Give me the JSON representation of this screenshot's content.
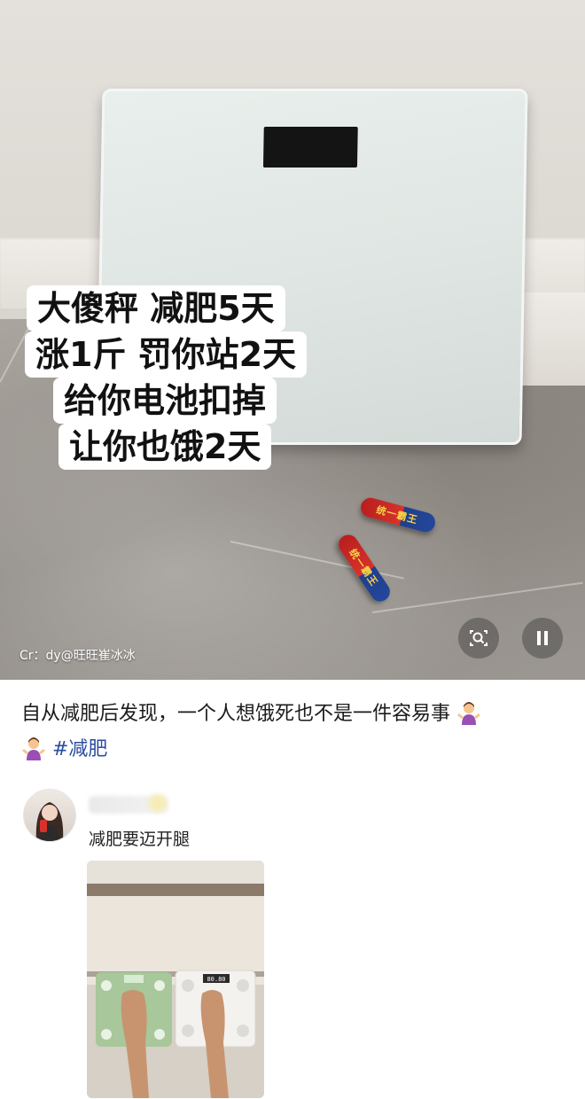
{
  "overlay": {
    "lines": [
      "大傻秤  减肥5天",
      "涨1斤  罚你站2天",
      "给你电池扣掉",
      "让你也饿2天"
    ]
  },
  "video": {
    "credit": "Cr：dy@旺旺崔冰冰",
    "battery_label": "统一霸王",
    "zoom_icon": "search-zoom-icon",
    "pause_icon": "pause-icon"
  },
  "post": {
    "text": "自从减肥后发现，一个人想饿死也不是一件容易事",
    "hashtag": "#减肥",
    "emoji": "person-shrugging-emoji"
  },
  "comment": {
    "text": "减肥要迈开腿",
    "scale_reading": "80.80"
  },
  "colors": {
    "hashtag": "#2b4ea0",
    "battery_red": "#d8322b",
    "battery_blue": "#24479b"
  }
}
